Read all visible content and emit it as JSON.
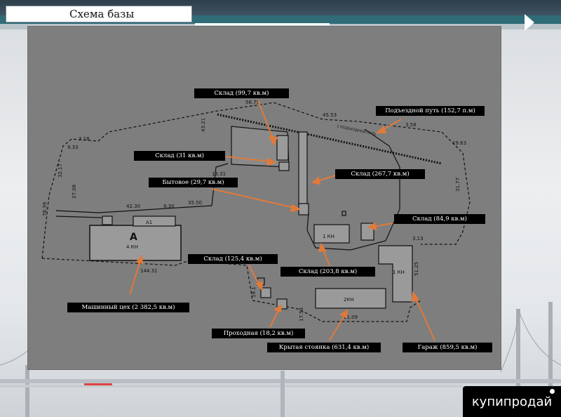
{
  "slide": {
    "title": "Схема базы"
  },
  "labels": {
    "sklad_99": "Склад (99,7 кв.м)",
    "podezdnoy": "Подъездной путь (152,7  п.м)",
    "sklad_31": "Склад (31 кв.м)",
    "sklad_267": "Склад (267,7  кв.м)",
    "bytovoe": "Бытовое (29,7 кв.м)",
    "sklad_84": "Склад (84,9 кв.м)",
    "sklad_125": "Склад (125,4  кв.м)",
    "sklad_203": "Склад (203,8 кв.м)",
    "mashinny": "Машинный цех  (2 382,5  кв.м)",
    "prohodnaya": "Проходная (18,2 кв.м)",
    "krytaya": "Крытая стоянка (631,4  кв.м)",
    "garazh": "Гараж (859,5  кв.м)"
  },
  "plan_text": {
    "d1": "56.75",
    "d2": "45.53",
    "d3": "43.21",
    "d4": "3.58",
    "d5": "19.63",
    "d6": "31.77",
    "d7": "13.31",
    "d8": "35.50",
    "d9": "42.30",
    "d10": "9.30",
    "d11": "27.08",
    "d12": "32.17",
    "d13": "9.33",
    "d14": "3.18",
    "d15": "78.39",
    "d16": "144.31",
    "d17": "61.09",
    "d18": "51.25",
    "d19": "3.13",
    "d20": "19.1",
    "d21": "17.53",
    "b_a": "A",
    "b_a_sub": "4 КН",
    "b_a1": "А1",
    "b_1kn": "1 КН",
    "b_2kn": "2КН",
    "b_1kn2": "1 КН",
    "rail": "1 ПОДЪЕЗДНОЙ ПУТЬ"
  },
  "colors": {
    "arrow": "#e07a3a",
    "panel": "#7e7e7e",
    "line": "#111111"
  },
  "watermark": {
    "text": "купипродай"
  }
}
